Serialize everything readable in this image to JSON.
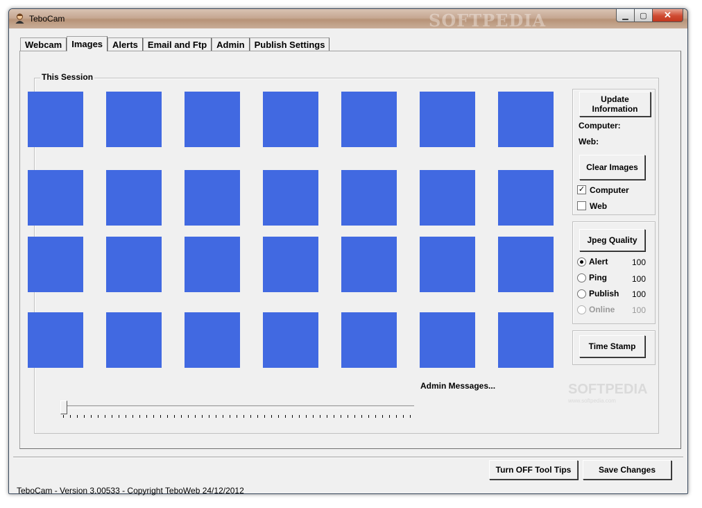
{
  "window": {
    "title": "TeboCam",
    "watermark": "SOFTPEDIA",
    "controls": {
      "minimize": "▁",
      "maximize": "▢",
      "close": "✕"
    }
  },
  "tabs": [
    {
      "label": "Webcam",
      "active": false
    },
    {
      "label": "Images",
      "active": true
    },
    {
      "label": "Alerts",
      "active": false
    },
    {
      "label": "Email and Ftp",
      "active": false
    },
    {
      "label": "Admin",
      "active": false
    },
    {
      "label": "Publish Settings",
      "active": false
    }
  ],
  "session": {
    "title": "This Session",
    "thumbnail_color": "#4169e1",
    "rows": 4,
    "columns": 7,
    "admin_messages": "Admin Messages..."
  },
  "info_panel": {
    "update_button": "Update Information",
    "computer_label": "Computer:",
    "web_label": "Web:",
    "clear_button": "Clear Images",
    "computer_checkbox": {
      "label": "Computer",
      "checked": true,
      "mark": "✓"
    },
    "web_checkbox": {
      "label": "Web",
      "checked": false
    }
  },
  "jpeg_panel": {
    "button": "Jpeg Quality",
    "options": [
      {
        "label": "Alert",
        "value": "100",
        "selected": true,
        "enabled": true
      },
      {
        "label": "Ping",
        "value": "100",
        "selected": false,
        "enabled": true
      },
      {
        "label": "Publish",
        "value": "100",
        "selected": false,
        "enabled": true
      },
      {
        "label": "Online",
        "value": "100",
        "selected": false,
        "enabled": false
      }
    ]
  },
  "time_stamp_button": "Time Stamp",
  "footer": {
    "tooltips_button": "Turn OFF Tool Tips",
    "save_button": "Save Changes",
    "status": "TeboCam - Version 3.00533 - Copyright TeboWeb 24/12/2012"
  },
  "watermark2": {
    "main": "SOFTPEDIA",
    "sub": "www.softpedia.com"
  }
}
